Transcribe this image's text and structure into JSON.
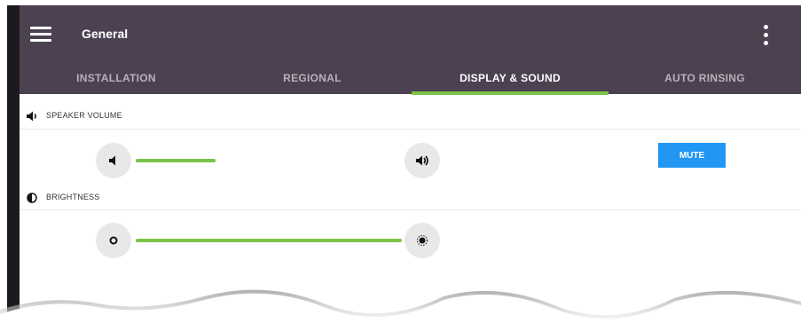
{
  "appbar": {
    "title": "General"
  },
  "tabs": [
    {
      "label": "INSTALLATION"
    },
    {
      "label": "REGIONAL"
    },
    {
      "label": "DISPLAY & SOUND",
      "active": true
    },
    {
      "label": "AUTO RINSING"
    }
  ],
  "speaker": {
    "label": "SPEAKER VOLUME",
    "level": 0.3,
    "mute_label": "MUTE"
  },
  "brightness": {
    "label": "BRIGHTNESS",
    "level": 1.0
  },
  "colors": {
    "appbar": "#4b4150",
    "accent": "#7cc34a",
    "mute_button": "#2196f3"
  },
  "icons": [
    "menu-icon",
    "overflow-menu-icon",
    "speaker-icon",
    "volume-down-icon",
    "volume-up-icon",
    "brightness-icon",
    "brightness-low-icon",
    "brightness-high-icon"
  ]
}
